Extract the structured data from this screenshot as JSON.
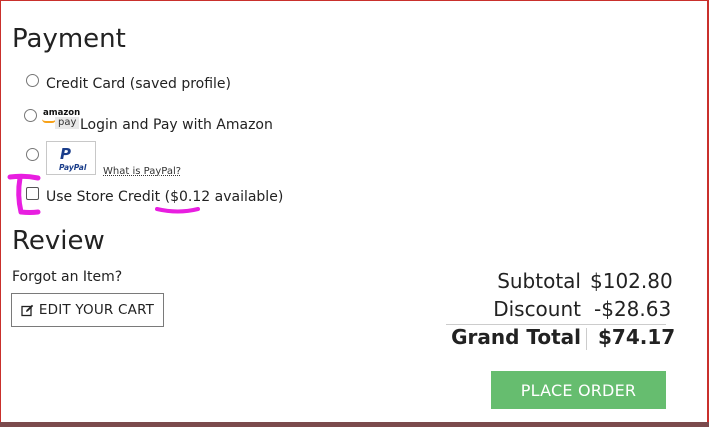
{
  "payment": {
    "title": "Payment",
    "options": [
      {
        "label": "Credit Card (saved profile)",
        "selected": false
      },
      {
        "label": "Login and Pay with Amazon",
        "selected": false
      },
      {
        "label": "",
        "selected": false
      }
    ],
    "amazon_logo": {
      "top": "amazon",
      "bottom": "pay"
    },
    "paypal_logo": {
      "mark": "P",
      "text": "PayPal"
    },
    "what_is_paypal": "What is PayPal?",
    "store_credit": {
      "label_prefix": "Use Store Credit (",
      "amount": "$0.12",
      "label_suffix": " available)",
      "checked": false
    }
  },
  "review": {
    "title": "Review",
    "forgot_text": "Forgot an Item?",
    "edit_cart_label": "EDIT YOUR CART"
  },
  "totals": {
    "subtotal_label": "Subtotal",
    "subtotal_value": "$102.80",
    "discount_label": "Discount",
    "discount_value": "-$28.63",
    "grand_total_label": "Grand Total",
    "grand_total_value": "$74.17"
  },
  "place_order_label": "PLACE ORDER",
  "colors": {
    "frame_border": "#c9302c",
    "place_order_bg": "#66bd6f",
    "annotation": "#e81ee0",
    "paypal_blue": "#1a3d8a",
    "amazon_orange": "#f7a21a"
  }
}
